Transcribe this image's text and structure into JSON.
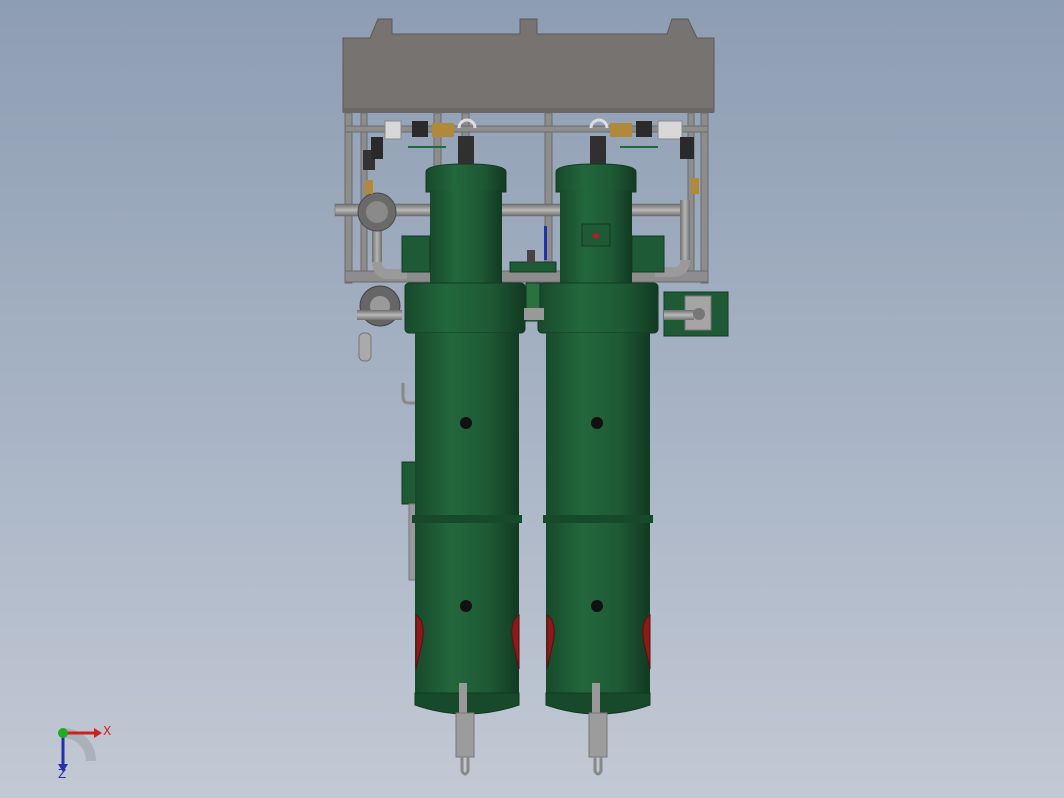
{
  "viewport": {
    "background_top": "#8e9db3",
    "background_bottom": "#c3c9d4"
  },
  "model": {
    "frame_color": "#8a8a8a",
    "top_box_color": "#7a7674",
    "vessel_color": "#1e5a35",
    "vessel_dark": "#143f25",
    "valve_brass": "#b08a3a",
    "gauge_red": "#8b1a1a",
    "blue_accent": "#2233aa"
  },
  "triad": {
    "x_label": "X",
    "z_label": "Z",
    "x_color": "#cc2222",
    "y_color": "#22aa22",
    "z_color": "#2233aa"
  }
}
